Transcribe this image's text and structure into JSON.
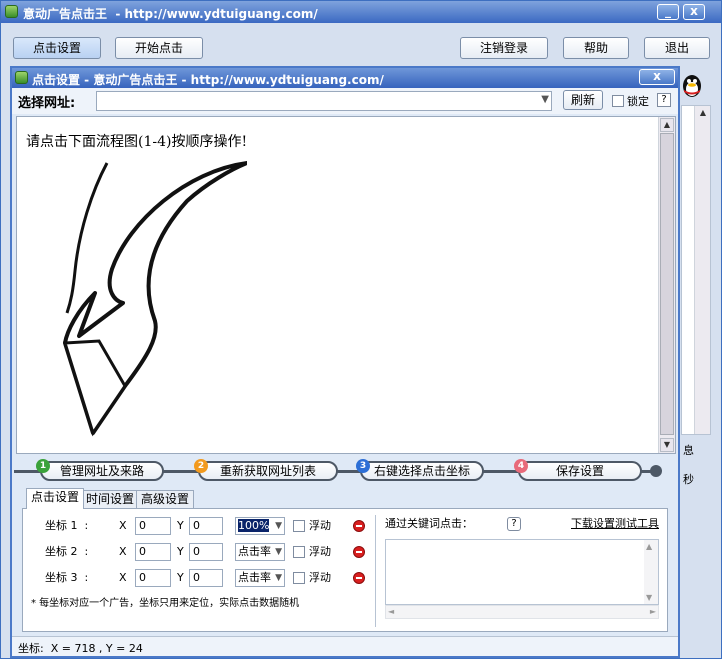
{
  "main_window": {
    "title": "意动广告点击王  - http://www.ydtuiguang.com/",
    "minimize": "_",
    "close": "x",
    "toolbar": {
      "click_settings": "点击设置",
      "start_click": "开始点击",
      "logout": "注销登录",
      "help": "帮助",
      "exit": "退出"
    },
    "side_text_1": "息",
    "side_text_2": "秒"
  },
  "child_window": {
    "title": "点击设置 - 意动广告点击王 - http://www.ydtuiguang.com/",
    "close": "x",
    "url_label": "选择网址:",
    "url_value": "",
    "refresh": "刷新",
    "lock_label": "锁定",
    "help": "?",
    "browser_text": "请点击下面流程图(1-4)按顺序操作!"
  },
  "steps": [
    {
      "num": "1",
      "label": "管理网址及来路",
      "color": "#3aa23a"
    },
    {
      "num": "2",
      "label": "重新获取网址列表",
      "color": "#f29a1e"
    },
    {
      "num": "3",
      "label": "右键选择点击坐标",
      "color": "#2d6fd6"
    },
    {
      "num": "4",
      "label": "保存设置",
      "color": "#e86a7a"
    }
  ],
  "tabs": [
    "点击设置",
    "时间设置",
    "高级设置"
  ],
  "coords": [
    {
      "label": "坐标 1  :",
      "x_label": "X",
      "x": "0",
      "y_label": "Y",
      "y": "0",
      "mode": "100%",
      "float": "浮动"
    },
    {
      "label": "坐标 2  :",
      "x_label": "X",
      "x": "0",
      "y_label": "Y",
      "y": "0",
      "mode": "点击率",
      "float": "浮动"
    },
    {
      "label": "坐标 3  :",
      "x_label": "X",
      "x": "0",
      "y_label": "Y",
      "y": "0",
      "mode": "点击率",
      "float": "浮动"
    }
  ],
  "note": "* 每坐标对应一个广告，坐标只用来定位，实际点击数据随机",
  "keyword_label": "通过关键词点击：",
  "keyword_help": "?",
  "download_link": "下载设置测试工具",
  "status": "坐标:  X = 718 , Y = 24"
}
